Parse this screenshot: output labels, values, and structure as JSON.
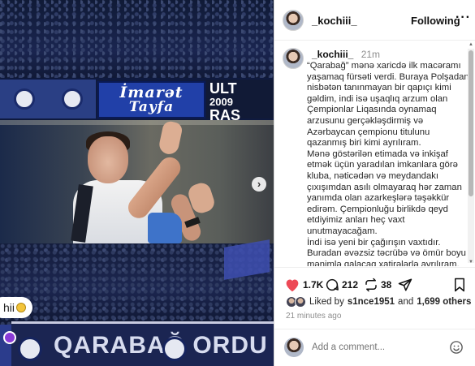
{
  "photo": {
    "banner_imarat_line1": "İmarət",
    "banner_imarat_line2": "Tayfa",
    "banner_ult_line1": "ULT",
    "banner_ult_line2": "2009",
    "banner_ult_line3": "RAS",
    "bottom_banner_text": "QARABAĞ  ORDU",
    "tag_text": "hii",
    "next_button": "›"
  },
  "post": {
    "username": "_kochiii_",
    "follow_label": "Following",
    "more_label": "···",
    "time_short": "21m",
    "caption_lines": [
      "“Qarabağ” mənə xaricdə ilk macəramı",
      "yaşamaq fürsəti verdi. Buraya Polşadan",
      "nisbətən tanınmayan bir qapıçı kimi",
      "gəldim, indi isə uşaqlıq arzum olan",
      "Çempionlar Liqasında oynamaq",
      "arzusunu gerçəkləşdirmiş və",
      "Azərbaycan çempionu titulunu",
      "qazanmış biri kimi ayrılıram.",
      "Mənə göstərilən etimada və inkişaf",
      "etmək üçün yaradılan imkanlara görə",
      "kluba, nəticədən və meydandakı",
      "çıxışımdan asılı olmayaraq hər zaman",
      "yanımda olan azarkeşlərə təşəkkür",
      "edirəm. Çempionluğu birlikdə qeyd",
      "etdiyimiz anları heç vaxt",
      "unutmayacağam.",
      "İndi isə yeni bir çağırışın vaxtıdır.",
      "Buradan əvəzsiz təcrübə və ömür boyu",
      "mənimlə qalacaq xatirələrlə ayrılıram."
    ],
    "likes_count": "1.7K",
    "comments_count": "212",
    "reposts_count": "38",
    "liked_by_prefix": "Liked by",
    "liked_by_user": "s1nce1951",
    "liked_by_and": "and",
    "liked_by_others": "1,699 others",
    "time_long": "21 minutes ago",
    "comment_placeholder": "Add a comment..."
  },
  "colors": {
    "like_red": "#ed4956",
    "text_secondary": "#8e8e8e",
    "banner_blue": "#2140a8"
  },
  "icons": [
    "heart-icon",
    "comment-icon",
    "repost-icon",
    "share-icon",
    "bookmark-icon",
    "emoji-icon",
    "more-icon",
    "chevron-right-icon"
  ]
}
